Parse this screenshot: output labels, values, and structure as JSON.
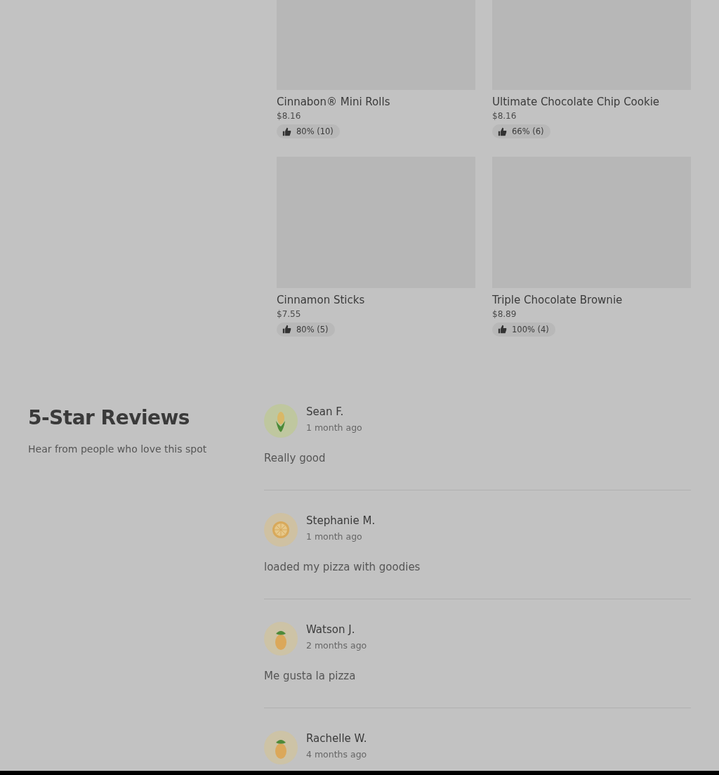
{
  "menu_items": [
    {
      "name": "Cinnabon® Mini Rolls",
      "price": "$8.16",
      "rating": "80% (10)"
    },
    {
      "name": "Ultimate Chocolate Chip Cookie",
      "price": "$8.16",
      "rating": "66% (6)"
    },
    {
      "name": "Cinnamon Sticks",
      "price": "$7.55",
      "rating": "80% (5)"
    },
    {
      "name": "Triple Chocolate Brownie",
      "price": "$8.89",
      "rating": "100% (4)"
    }
  ],
  "reviews_section": {
    "title": "5-Star Reviews",
    "subtitle": "Hear from people who love this spot"
  },
  "reviews": [
    {
      "name": "Sean F.",
      "time": "1 month ago",
      "text": "Really good",
      "kind": "corn"
    },
    {
      "name": "Stephanie M.",
      "time": "1 month ago",
      "text": "loaded my pizza with goodies",
      "kind": "citrus"
    },
    {
      "name": "Watson J.",
      "time": "2 months ago",
      "text": "Me gusta la pizza",
      "kind": "pineapple"
    },
    {
      "name": "Rachelle W.",
      "time": "4 months ago",
      "kind": "pineapple"
    }
  ]
}
